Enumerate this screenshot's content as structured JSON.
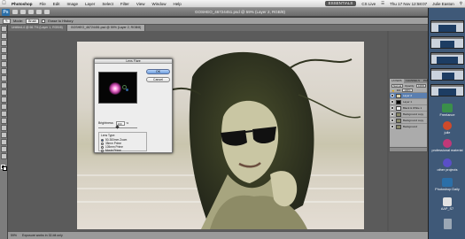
{
  "menubar": {
    "items": [
      "Photoshop",
      "File",
      "Edit",
      "Image",
      "Layer",
      "Select",
      "Filter",
      "View",
      "Window",
      "Help"
    ],
    "clock": "Thu 17 Nov  12:58:07",
    "user": "Julie Easton"
  },
  "appbar": {
    "logo": "Ps",
    "doc_title": "GOSHEO_46724451.psd @ 59% (Layer 2, RGB/8)",
    "workspace": "ESSENTIALS",
    "cs_live": "CS Live"
  },
  "options": {
    "tool_preset": "Mode:",
    "mode_value": "Brush",
    "flow_label": "Erase to History",
    "checkbox_label": "Erase to History"
  },
  "tabs": [
    "Untitled-4 @ 66.7% (Layer 1, RGB/8)",
    "GOSHEO_46724451.psd @ 59% (Layer 2, RGB/8)"
  ],
  "dialog": {
    "title": "Lens Flare",
    "ok": "OK",
    "cancel": "Cancel",
    "brightness_label": "Brightness:",
    "brightness_value": "100",
    "brightness_unit": "%",
    "lens_type_label": "Lens Type:",
    "lens_options": [
      "50-300mm Zoom",
      "35mm Prime",
      "105mm Prime",
      "Movie Prime"
    ],
    "lens_selected": 0
  },
  "layers": {
    "tabs": [
      "LAYERS",
      "CHANNELS",
      "PATHS"
    ],
    "blend_mode": "Normal",
    "opacity_label": "Opacity:",
    "opacity_value": "100%",
    "fill_label": "Fill:",
    "fill_value": "100%",
    "items": [
      "Layer 2",
      "Layer 1",
      "Black & White 1",
      "Background copy",
      "Background copy",
      "Background"
    ],
    "selected": 0
  },
  "status": {
    "zoom": "59%",
    "info": "Exposure works in 32-bit only"
  },
  "dock": {
    "items": [
      "Freelance",
      "julie",
      "professional material",
      "other projects",
      "Photoshop Daily",
      "AAP_S7"
    ],
    "colors": [
      "#3a8f4a",
      "#d04a2a",
      "#c03878",
      "#5a4fc8",
      "#2b6fa8",
      "#e2e2e2"
    ]
  }
}
